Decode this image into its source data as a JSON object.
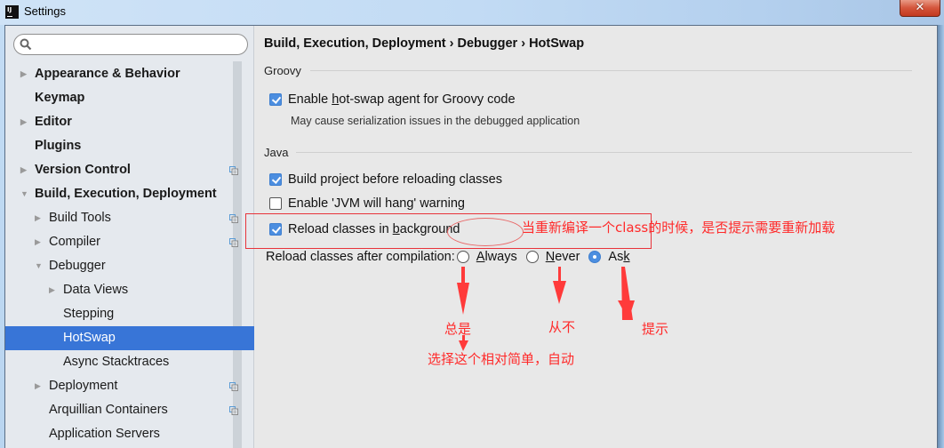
{
  "window": {
    "title": "Settings",
    "app_icon": "IJ",
    "close_label": "✕"
  },
  "sidebar": {
    "search": {
      "placeholder": "",
      "value": ""
    },
    "items": [
      {
        "label": "Appearance & Behavior",
        "level": 0,
        "bold": true,
        "arrow": "collapsed",
        "project_icon": false
      },
      {
        "label": "Keymap",
        "level": 0,
        "bold": true,
        "arrow": "none",
        "project_icon": false
      },
      {
        "label": "Editor",
        "level": 0,
        "bold": true,
        "arrow": "collapsed",
        "project_icon": false
      },
      {
        "label": "Plugins",
        "level": 0,
        "bold": true,
        "arrow": "none",
        "project_icon": false
      },
      {
        "label": "Version Control",
        "level": 0,
        "bold": true,
        "arrow": "collapsed",
        "project_icon": true
      },
      {
        "label": "Build, Execution, Deployment",
        "level": 0,
        "bold": true,
        "arrow": "expanded",
        "project_icon": false
      },
      {
        "label": "Build Tools",
        "level": 1,
        "bold": false,
        "arrow": "collapsed",
        "project_icon": true
      },
      {
        "label": "Compiler",
        "level": 1,
        "bold": false,
        "arrow": "collapsed",
        "project_icon": true
      },
      {
        "label": "Debugger",
        "level": 1,
        "bold": false,
        "arrow": "expanded",
        "project_icon": false
      },
      {
        "label": "Data Views",
        "level": 2,
        "bold": false,
        "arrow": "collapsed",
        "project_icon": false
      },
      {
        "label": "Stepping",
        "level": 2,
        "bold": false,
        "arrow": "none",
        "project_icon": false
      },
      {
        "label": "HotSwap",
        "level": 2,
        "bold": false,
        "arrow": "none",
        "project_icon": false,
        "selected": true
      },
      {
        "label": "Async Stacktraces",
        "level": 2,
        "bold": false,
        "arrow": "none",
        "project_icon": false
      },
      {
        "label": "Deployment",
        "level": 1,
        "bold": false,
        "arrow": "collapsed",
        "project_icon": true
      },
      {
        "label": "Arquillian Containers",
        "level": 1,
        "bold": false,
        "arrow": "none",
        "project_icon": true
      },
      {
        "label": "Application Servers",
        "level": 1,
        "bold": false,
        "arrow": "none",
        "project_icon": false
      }
    ]
  },
  "main": {
    "breadcrumb": "Build, Execution, Deployment › Debugger › HotSwap",
    "groups": {
      "groovy": {
        "title": "Groovy",
        "hotswap_agent": {
          "pre": "Enable ",
          "mnemonic": "h",
          "post": "ot-swap agent for Groovy code",
          "checked": true
        },
        "hint": "May cause serialization issues in the debugged application"
      },
      "java": {
        "title": "Java",
        "build_before_reload": {
          "label": "Build project before reloading classes",
          "checked": true
        },
        "jvm_hang_warning": {
          "label": "Enable 'JVM will hang' warning",
          "checked": false
        },
        "reload_background": {
          "pre": "Reload classes in ",
          "mnemonic": "b",
          "post": "ackground",
          "checked": true
        }
      }
    },
    "reload_after_compilation": {
      "label": "Reload classes after compilation:",
      "options": [
        {
          "mnemonic": "A",
          "rest": "lways",
          "selected": false
        },
        {
          "mnemonic": "N",
          "rest": "ever",
          "selected": false
        },
        {
          "pre": "As",
          "mnemonic": "k",
          "selected": true
        }
      ]
    }
  },
  "annotations": {
    "color": "#ff2a2a",
    "header_note": "当重新编译一个class的时候，是否提示需要重新加载",
    "always_note": "总是",
    "never_note": "从不",
    "ask_note": "提示",
    "choice_note": "选择这个相对简单，自动"
  }
}
